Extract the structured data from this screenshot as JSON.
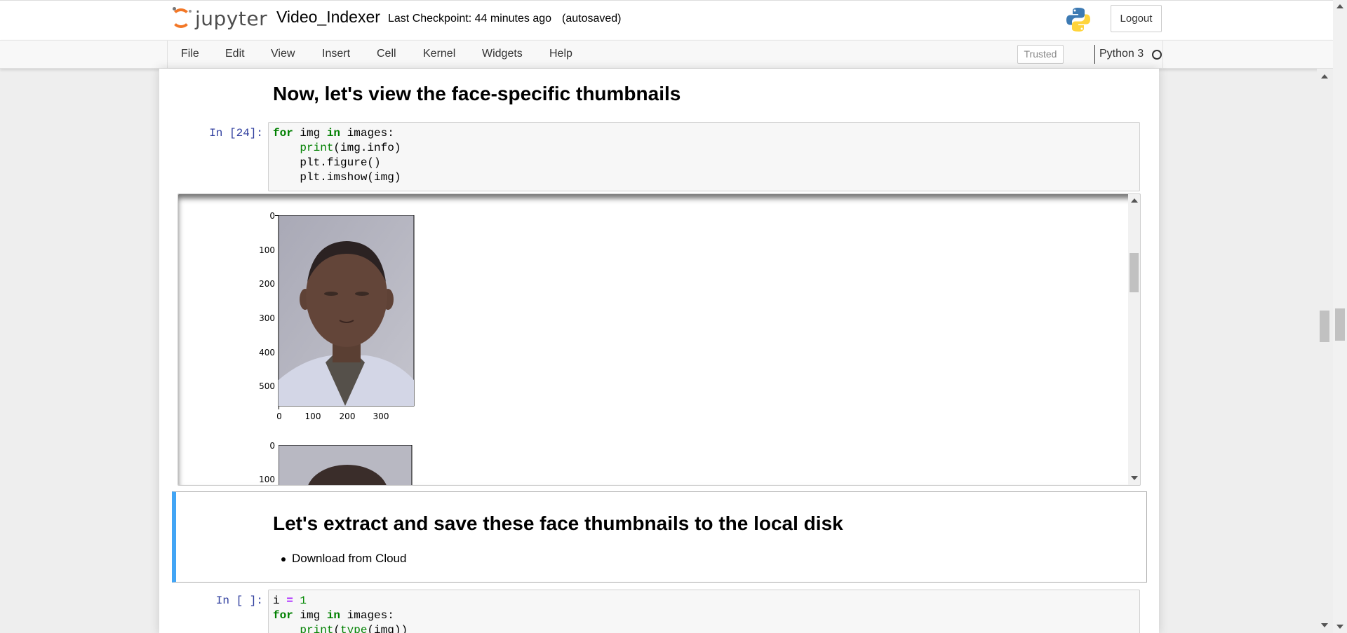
{
  "header": {
    "logo_text": "jupyter",
    "notebook_name": "Video_Indexer",
    "checkpoint": "Last Checkpoint: 44 minutes ago",
    "autosave": "(autosaved)",
    "logout_label": "Logout"
  },
  "menubar": {
    "items": [
      "File",
      "Edit",
      "View",
      "Insert",
      "Cell",
      "Kernel",
      "Widgets",
      "Help"
    ],
    "trusted_label": "Trusted",
    "kernel_name": "Python 3"
  },
  "cells": {
    "heading1": "Now, let's view the face-specific thumbnails",
    "code1": {
      "prompt": "In [24]:"
    },
    "output": {
      "plot1": {
        "yticks": [
          "0",
          "100",
          "200",
          "300",
          "400",
          "500"
        ],
        "xticks": [
          "0",
          "100",
          "200",
          "300"
        ]
      },
      "plot2": {
        "yticks": [
          "0",
          "100"
        ]
      }
    },
    "markdown": {
      "heading": "Let's extract and save these face thumbnails to the local disk",
      "bullet": "Download from Cloud"
    },
    "code2": {
      "prompt": "In [ ]:"
    }
  },
  "colors": {
    "accent_selected": "#42a5f5",
    "prompt_in": "#303f9f",
    "logo_orange": "#f37726"
  }
}
